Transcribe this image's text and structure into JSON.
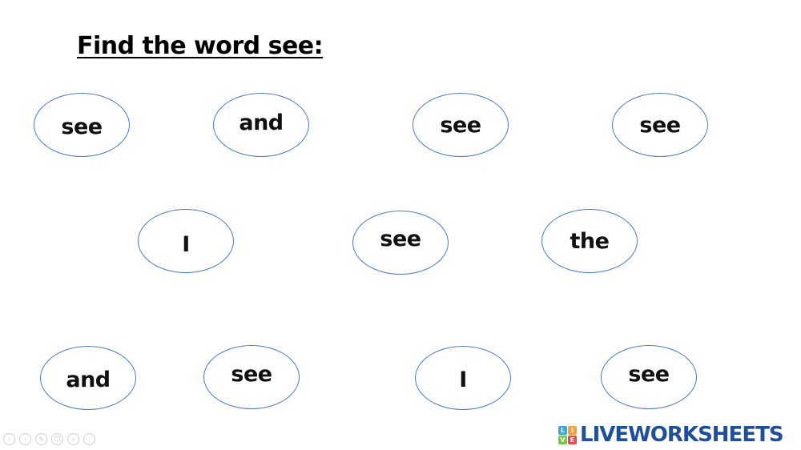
{
  "title": "Find the word see:",
  "words": [
    {
      "label": "see"
    },
    {
      "label": "and"
    },
    {
      "label": "see"
    },
    {
      "label": "see"
    },
    {
      "label": "I"
    },
    {
      "label": "see"
    },
    {
      "label": "the"
    },
    {
      "label": "and"
    },
    {
      "label": "see"
    },
    {
      "label": "I"
    },
    {
      "label": "see"
    }
  ],
  "controls": [
    {
      "icon": "previous-icon",
      "glyph": "‹"
    },
    {
      "icon": "next-icon",
      "glyph": "›"
    },
    {
      "icon": "pen-icon",
      "glyph": "✎"
    },
    {
      "icon": "copy-icon",
      "glyph": "❐"
    },
    {
      "icon": "zoom-icon",
      "glyph": "⌕"
    },
    {
      "icon": "more-icon",
      "glyph": "···"
    }
  ],
  "brand": {
    "name": "LIVEWORKSHEETS",
    "logo_letters": [
      "L",
      "I",
      "V",
      "E"
    ],
    "logo_colors": [
      "#3fa7d6",
      "#f2a33a",
      "#7cc24a",
      "#e5484d"
    ],
    "text_color": "#1f4f9a"
  },
  "colors": {
    "oval_border": "#4a78c2"
  }
}
